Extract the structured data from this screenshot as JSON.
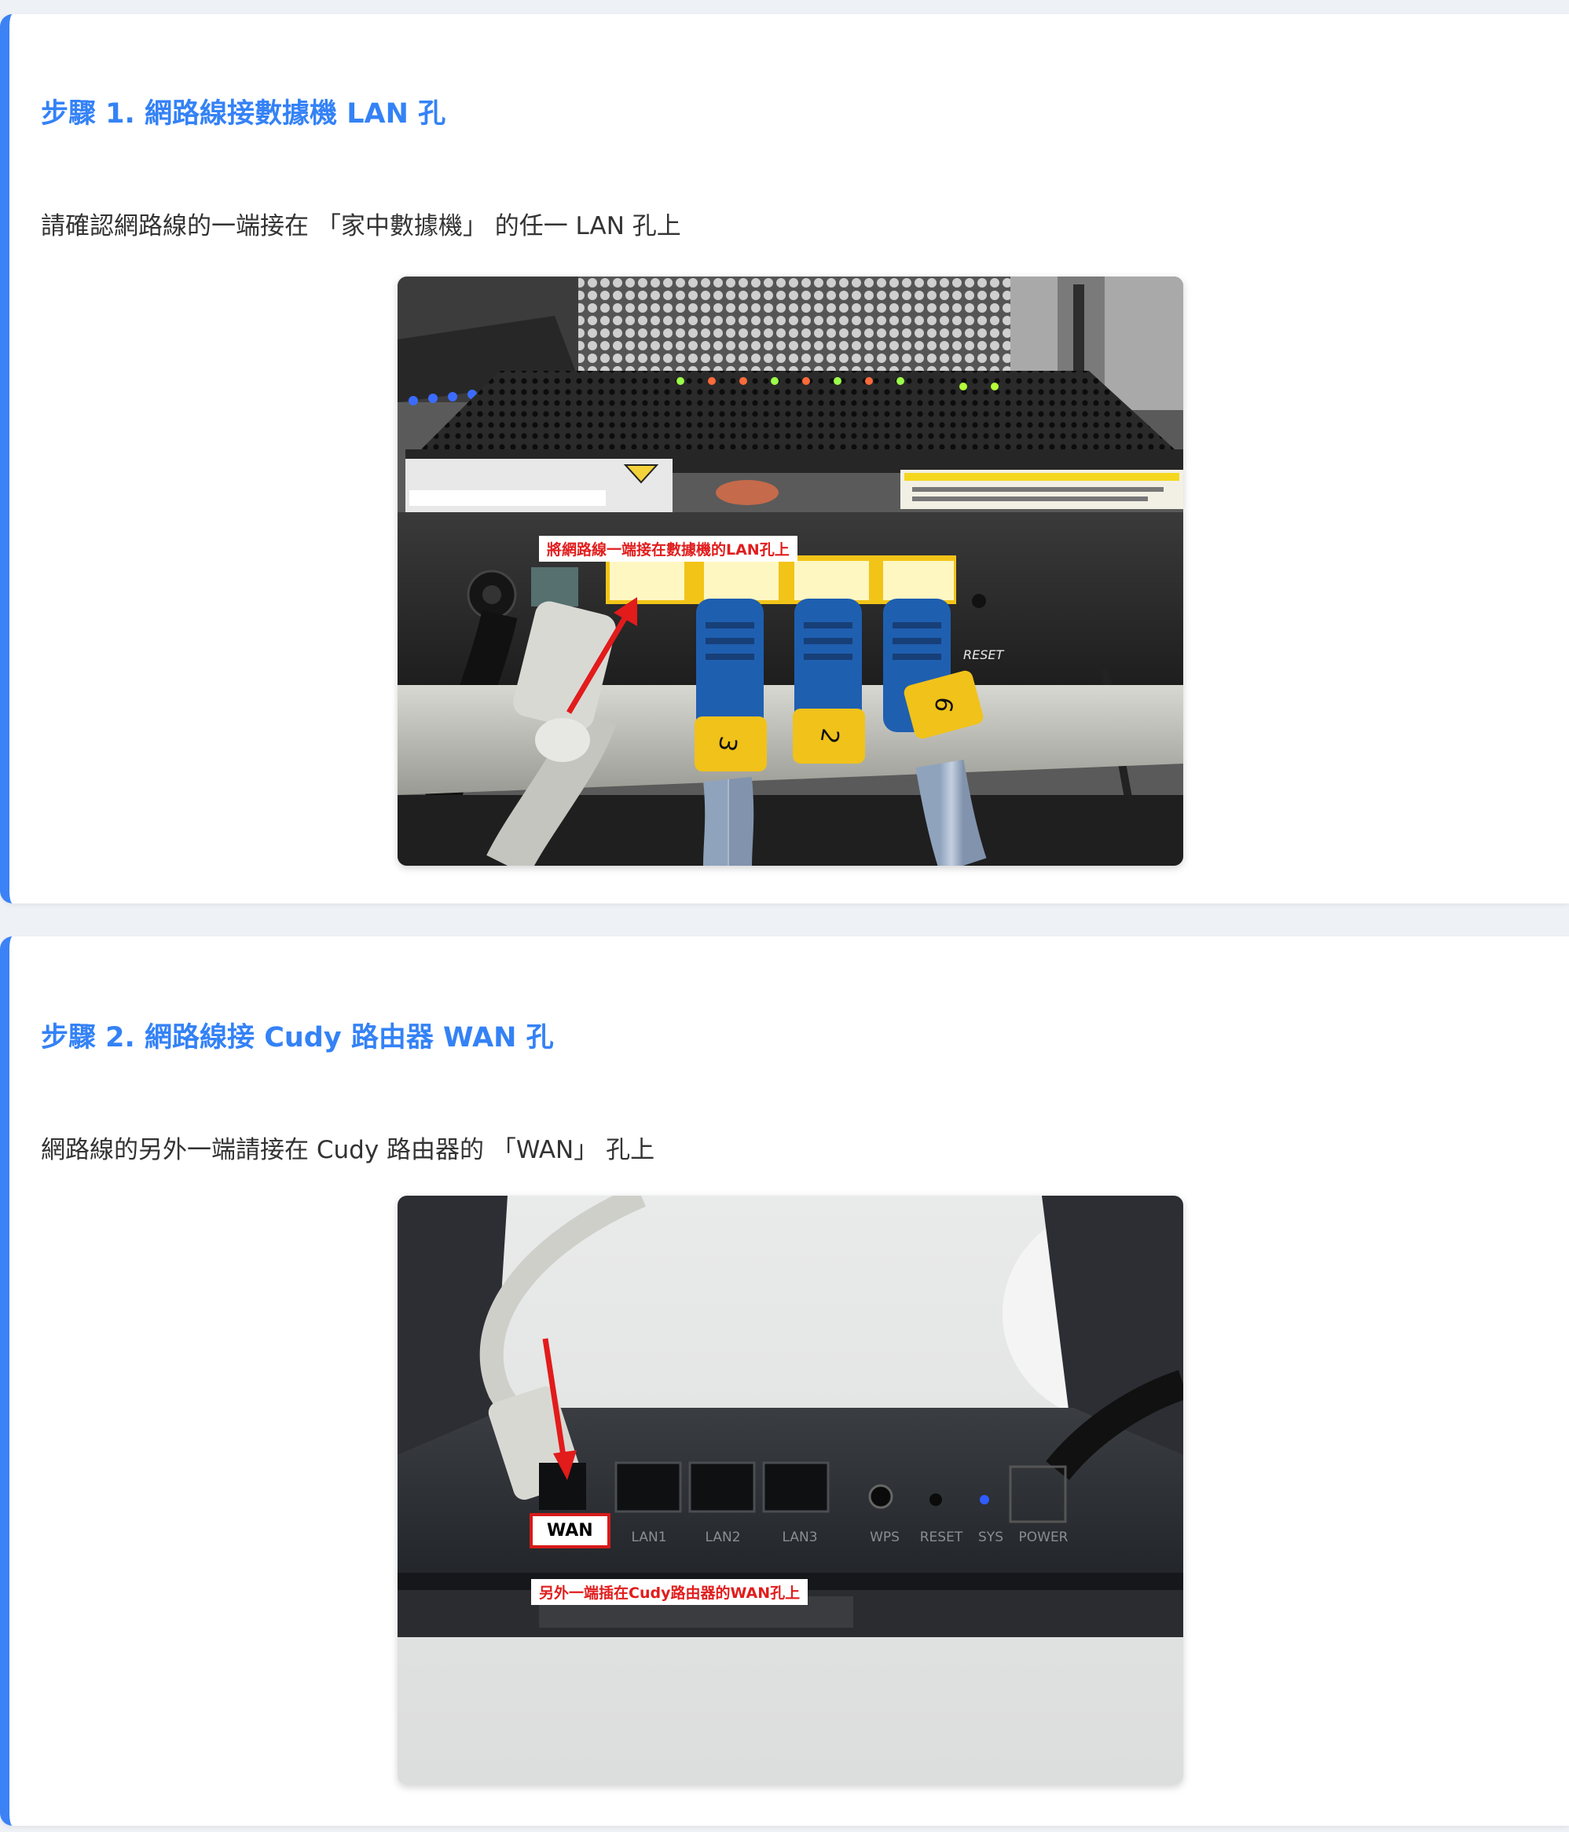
{
  "steps": [
    {
      "title": "步驟 1. 網路線接數據機 LAN 孔",
      "description": "請確認網路線的一端接在 「家中數據機」 的任一 LAN 孔上",
      "image": {
        "callout": "將網路線一端接在數據機的LAN孔上",
        "cable_numbers": [
          "3",
          "2",
          "6"
        ],
        "device_labels": [
          "RESET"
        ]
      }
    },
    {
      "title": "步驟 2. 網路線接 Cudy 路由器 WAN 孔",
      "description": "網路線的另外一端請接在 Cudy 路由器的 「WAN」 孔上",
      "image": {
        "port_tag": "WAN",
        "callout": "另外一端插在Cudy路由器的WAN孔上",
        "port_labels": [
          "LAN1",
          "LAN2",
          "LAN3",
          "WPS",
          "RESET",
          "SYS",
          "POWER"
        ]
      }
    }
  ],
  "colors": {
    "accent": "#3b82f6",
    "title": "#3482f6",
    "callout_red": "#e11d1d",
    "card_bg": "#ffffff",
    "page_bg": "#eef1f5"
  }
}
